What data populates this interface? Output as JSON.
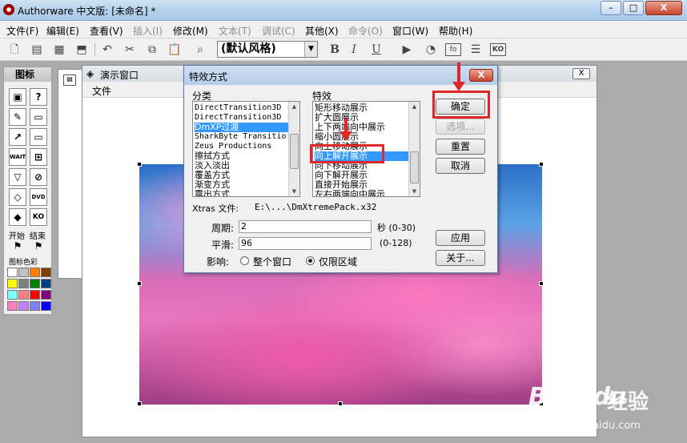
{
  "window": {
    "title": "Authorware 中文版: [未命名] *",
    "min": "–",
    "max": "□",
    "close": "X"
  },
  "menubar": [
    {
      "label": "文件(F)",
      "enabled": true
    },
    {
      "label": "编辑(E)",
      "enabled": true
    },
    {
      "label": "查看(V)",
      "enabled": true
    },
    {
      "label": "插入(I)",
      "enabled": false
    },
    {
      "label": "修改(M)",
      "enabled": true
    },
    {
      "label": "文本(T)",
      "enabled": false
    },
    {
      "label": "调试(C)",
      "enabled": false
    },
    {
      "label": "其他(X)",
      "enabled": true
    },
    {
      "label": "命令(O)",
      "enabled": false
    },
    {
      "label": "窗口(W)",
      "enabled": true
    },
    {
      "label": "帮助(H)",
      "enabled": true
    }
  ],
  "toolbar": {
    "style_value": "(默认风格)",
    "bold": "B",
    "italic": "I",
    "underline": "U",
    "fo": "fo",
    "ko": "KO"
  },
  "palette": {
    "title": "图标",
    "start_label": "开始",
    "end_label": "结束",
    "color_label": "图标色彩",
    "icons": [
      "display-icon",
      "motion-icon",
      "erase-icon",
      "wait-icon",
      "navigate-icon",
      "framework-icon",
      "decision-icon",
      "interaction-icon",
      "calculation-icon",
      "map-icon",
      "digital-movie-icon",
      "sound-icon",
      "video-icon",
      "knowledge-object-icon"
    ],
    "icon_text": {
      "wait": "WAIT",
      "dvd": "DVD",
      "ko": "KO"
    },
    "swatches": [
      "#ffffff",
      "#c0c0c0",
      "#ff8000",
      "#804000",
      "#ffff00",
      "#808080",
      "#008000",
      "#004080",
      "#80ffff",
      "#ff8080",
      "#ff0000",
      "#800080",
      "#ff80c0",
      "#c080ff",
      "#8080ff",
      "#0000ff"
    ]
  },
  "presentation": {
    "title": "演示窗口",
    "menu_file": "文件",
    "close": "X"
  },
  "dialog": {
    "title": "特效方式",
    "close": "X",
    "category_label": "分类",
    "effect_label": "特效",
    "categories": [
      "DirectTransition3D :",
      "DirectTransition3D :",
      "DmXP过渡",
      "SharkByte Transitio:",
      "Zeus Productions",
      "擦拭方式",
      "淡入淡出",
      "覆盖方式",
      "渐变方式",
      "露出方式"
    ],
    "category_selected": 2,
    "effects": [
      "矩形移动展示",
      "扩大圆展示",
      "上下两端向中展示",
      "缩小圆展示",
      "向上移动展示",
      "向上解开展示",
      "向下移动展示",
      "向下解开展示",
      "直接开始展示",
      "左右两端向中展示"
    ],
    "effect_selected": 5,
    "xtras_label": "Xtras 文件:",
    "xtras_path": "E:\\...\\DmXtremePack.x32",
    "period_label": "周期:",
    "period_value": "2",
    "period_unit": "秒 (0-30)",
    "smooth_label": "平滑:",
    "smooth_value": "96",
    "smooth_range": "(0-128)",
    "affect_label": "影响:",
    "affect_opt1": "整个窗口",
    "affect_opt2": "仅限区域",
    "affect_selected": 2,
    "btn_ok": "确定",
    "btn_options": "选项...",
    "btn_reset": "重置",
    "btn_cancel": "取消",
    "btn_apply": "应用",
    "btn_about": "关于..."
  },
  "watermark": {
    "brand": "Bai",
    "paw": "☺",
    "brand2": "du",
    "cn": "经验",
    "url": "jingyan.baidu.com"
  },
  "annotation_color": "#e0282b"
}
